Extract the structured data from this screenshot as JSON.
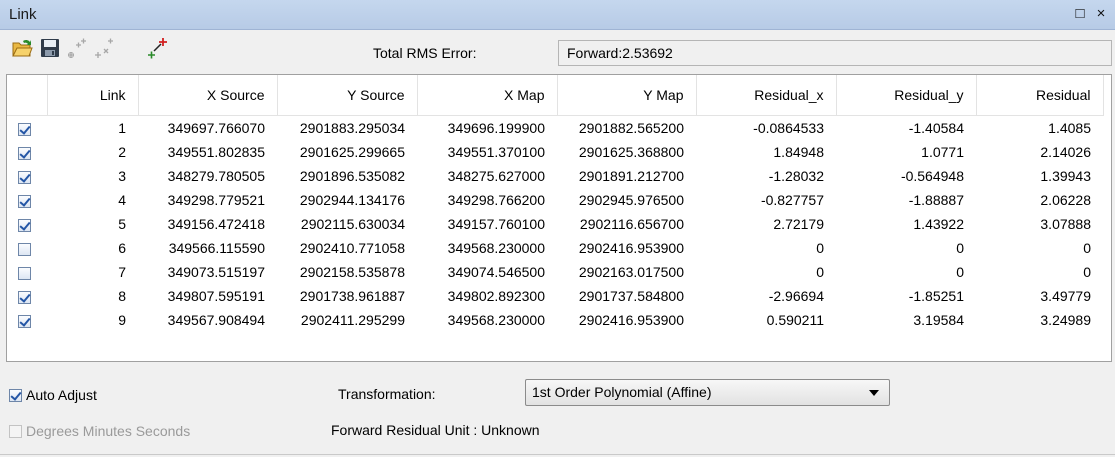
{
  "window": {
    "title": "Link",
    "restore_glyph": "□",
    "close_glyph": "×"
  },
  "toolbar": {
    "icons": [
      "open-folder-icon",
      "save-icon",
      "delete-link-icon",
      "delete-all-links-icon",
      "add-link-icon"
    ],
    "rms_label": "Total RMS Error:",
    "rms_value": "Forward:2.53692"
  },
  "table": {
    "columns": [
      "",
      "Link",
      "X Source",
      "Y Source",
      "X Map",
      "Y Map",
      "Residual_x",
      "Residual_y",
      "Residual"
    ],
    "rows": [
      {
        "checked": true,
        "cells": [
          "1",
          "349697.766070",
          "2901883.295034",
          "349696.199900",
          "2901882.565200",
          "-0.0864533",
          "-1.40584",
          "1.4085"
        ]
      },
      {
        "checked": true,
        "cells": [
          "2",
          "349551.802835",
          "2901625.299665",
          "349551.370100",
          "2901625.368800",
          "1.84948",
          "1.0771",
          "2.14026"
        ]
      },
      {
        "checked": true,
        "cells": [
          "3",
          "348279.780505",
          "2901896.535082",
          "348275.627000",
          "2901891.212700",
          "-1.28032",
          "-0.564948",
          "1.39943"
        ]
      },
      {
        "checked": true,
        "cells": [
          "4",
          "349298.779521",
          "2902944.134176",
          "349298.766200",
          "2902945.976500",
          "-0.827757",
          "-1.88887",
          "2.06228"
        ]
      },
      {
        "checked": true,
        "cells": [
          "5",
          "349156.472418",
          "2902115.630034",
          "349157.760100",
          "2902116.656700",
          "2.72179",
          "1.43922",
          "3.07888"
        ]
      },
      {
        "checked": false,
        "cells": [
          "6",
          "349566.115590",
          "2902410.771058",
          "349568.230000",
          "2902416.953900",
          "0",
          "0",
          "0"
        ]
      },
      {
        "checked": false,
        "cells": [
          "7",
          "349073.515197",
          "2902158.535878",
          "349074.546500",
          "2902163.017500",
          "0",
          "0",
          "0"
        ]
      },
      {
        "checked": true,
        "cells": [
          "8",
          "349807.595191",
          "2901738.961887",
          "349802.892300",
          "2901737.584800",
          "-2.96694",
          "-1.85251",
          "3.49779"
        ]
      },
      {
        "checked": true,
        "cells": [
          "9",
          "349567.908494",
          "2902411.295299",
          "349568.230000",
          "2902416.953900",
          "0.590211",
          "3.19584",
          "3.24989"
        ]
      }
    ]
  },
  "options": {
    "auto_adjust": {
      "label": "Auto Adjust",
      "checked": true
    },
    "dms": {
      "label": "Degrees Minutes Seconds",
      "checked": false,
      "enabled": false
    },
    "transformation_label": "Transformation:",
    "transformation_value": "1st Order Polynomial (Affine)",
    "residual_unit": "Forward Residual Unit : Unknown"
  }
}
